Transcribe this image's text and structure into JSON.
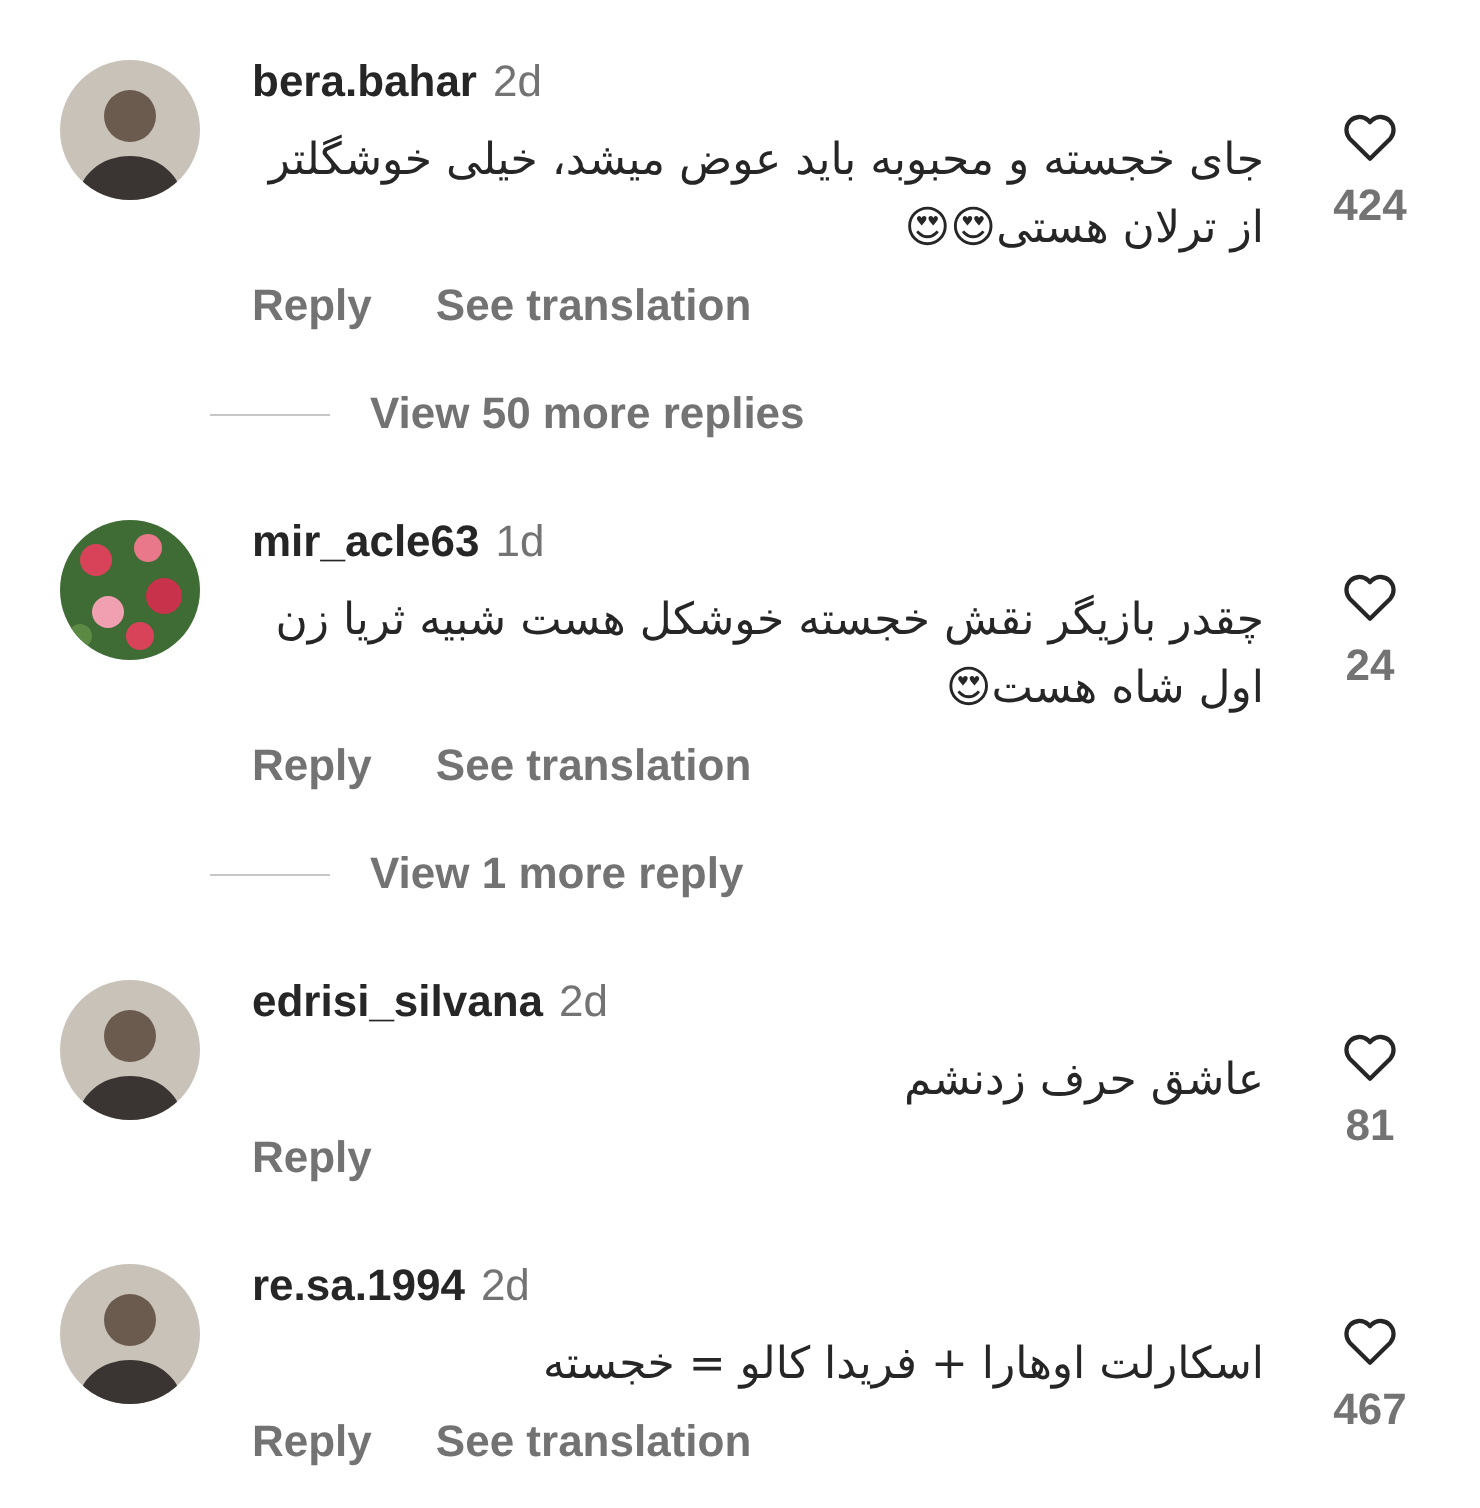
{
  "comments": [
    {
      "avatar": {
        "kind": "person"
      },
      "username": "bera.bahar",
      "time": "2d",
      "text": "جای خجسته و محبوبه باید عوض میشد، خیلی خوشگلتر از ترلان هستی😍😍",
      "actions": [
        "Reply",
        "See translation"
      ],
      "likes": "424",
      "view_replies": "View 50 more replies"
    },
    {
      "username": "mir_acle63",
      "time": "1d",
      "text": "چقدر بازیگر نقش خجسته خوشکل هست شبیه ثریا زن اول شاه هست😍",
      "actions": [
        "Reply",
        "See translation"
      ],
      "likes": "24",
      "view_replies": "View 1 more reply"
    },
    {
      "avatar": {
        "kind": "person"
      },
      "username": "edrisi_silvana",
      "time": "2d",
      "text": "عاشق حرف زدنشم",
      "actions": [
        "Reply"
      ],
      "likes": "81"
    },
    {
      "avatar": {
        "kind": "person"
      },
      "username": "re.sa.1994",
      "time": "2d",
      "text": "اسکارلت اوهارا + فریدا کالو = خجسته",
      "actions": [
        "Reply",
        "See translation"
      ],
      "likes": "467"
    }
  ]
}
